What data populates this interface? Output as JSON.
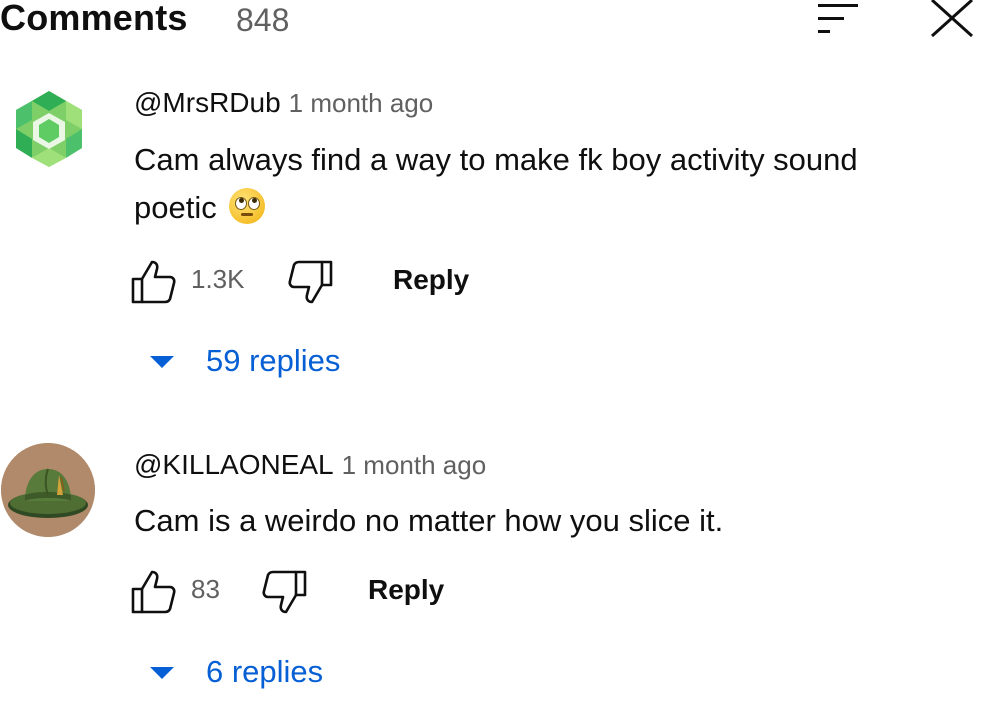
{
  "header": {
    "title": "Comments",
    "count": "848"
  },
  "comments": [
    {
      "author": "@MrsRDub",
      "time": "1 month ago",
      "text_line1": "Cam always find a way to make fk boy activity sound",
      "text_line2": "poetic",
      "emoji": "face-with-rolling-eyes",
      "likes": "1.3K",
      "reply_label": "Reply",
      "replies_label": "59 replies"
    },
    {
      "author": "@KILLAONEAL",
      "time": "1 month ago",
      "text": "Cam is a weirdo no matter how you slice it.",
      "likes": "83",
      "reply_label": "Reply",
      "replies_label": "6 replies"
    }
  ],
  "icons": {
    "sort": "sort-icon",
    "close": "close-icon",
    "like": "thumbs-up-icon",
    "dislike": "thumbs-down-icon",
    "expand": "caret-down-icon"
  },
  "colors": {
    "link": "#065fd4",
    "secondary_text": "#606060",
    "primary_text": "#0f0f0f"
  }
}
